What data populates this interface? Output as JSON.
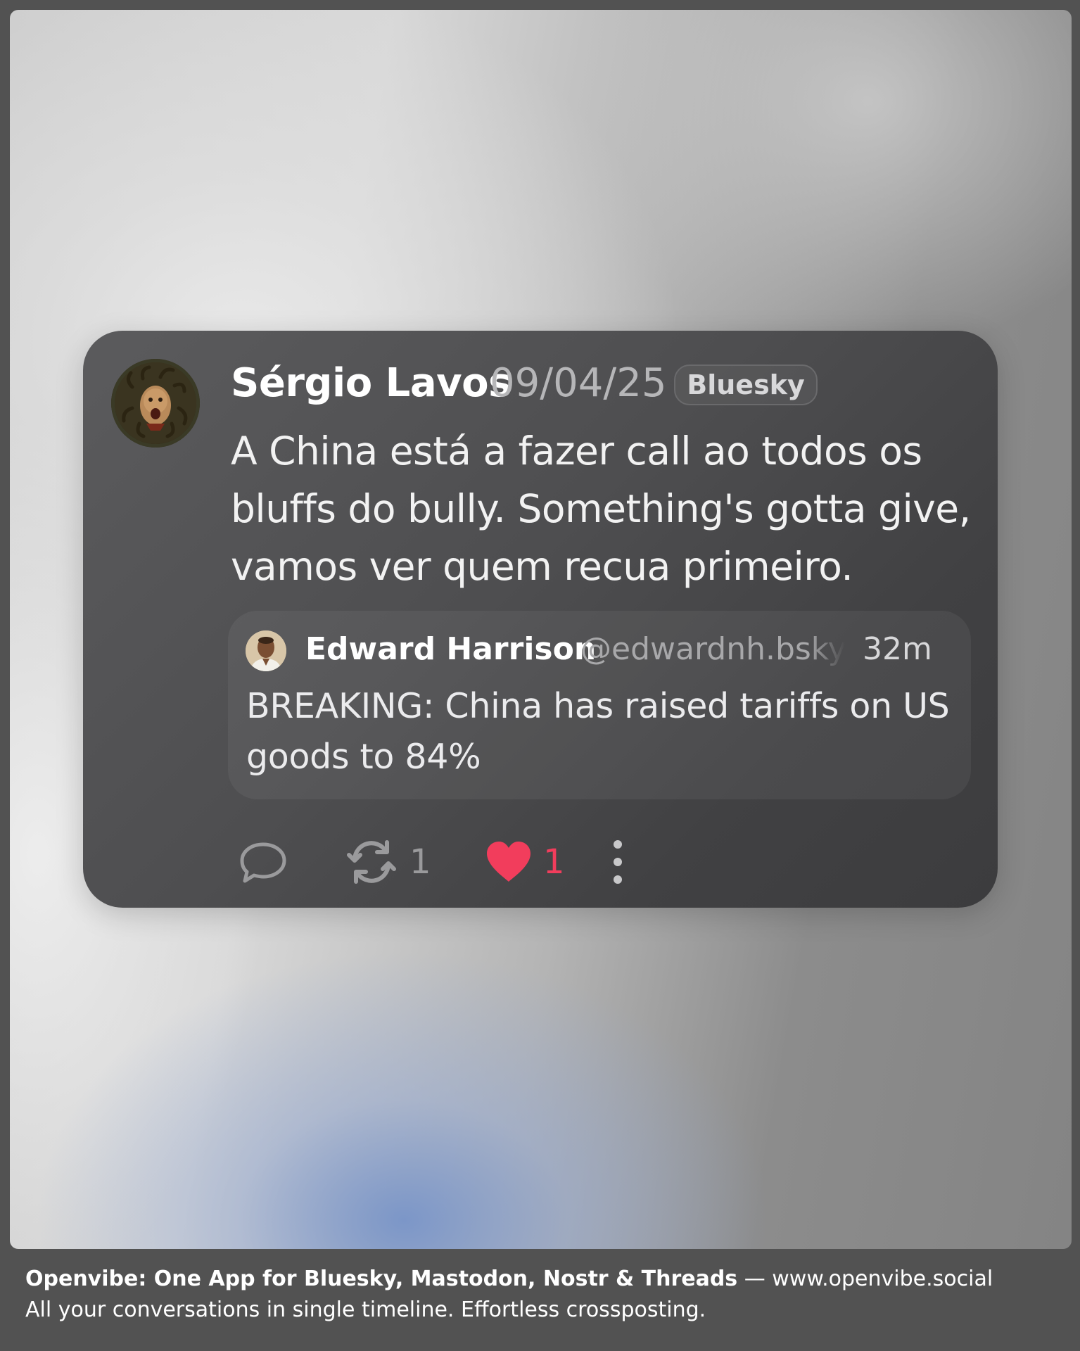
{
  "post": {
    "author_name": "Sérgio Lavos",
    "date": "09/04/25",
    "platform_badge": "Bluesky",
    "text": "A China está a fazer call ao todos os bluffs do bully. Something's gotta give, vamos ver quem recua primeiro.",
    "quoted_post": {
      "author_name": "Edward Harrison",
      "handle": "@edwardnh.bsky.social",
      "time": "32m",
      "text": "BREAKING: China has raised tariffs on US goods to 84%"
    },
    "actions": {
      "repost_count": "1",
      "like_count": "1",
      "liked": true
    }
  },
  "colors": {
    "like_accent": "#f23d5c",
    "card_background": "#4e4e50",
    "icon_gray": "#9a9a9c"
  },
  "icons": {
    "reply": "speech-bubble-icon",
    "repost": "repost-arrows-icon",
    "like": "heart-icon",
    "more": "vertical-dots-icon"
  },
  "footer": {
    "brand_line": "Openvibe: One App for Bluesky, Mastodon, Nostr & Threads",
    "separator": " — ",
    "url": "www.openvibe.social",
    "tagline": "All your conversations in single timeline. Effortless crossposting."
  }
}
